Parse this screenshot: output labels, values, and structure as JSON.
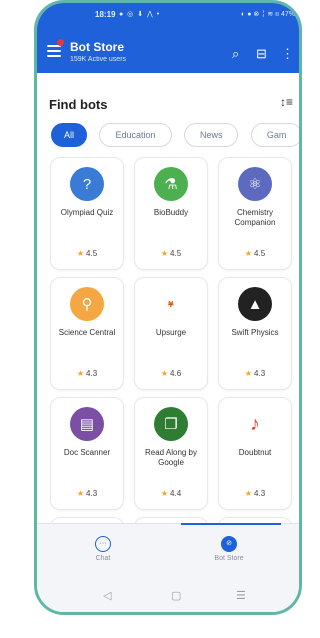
{
  "status_bar": {
    "time": "18:19",
    "left_icons": "● ◎ ⬇ ⋀ •",
    "right_icons": "◐ ● ⊗ ╎ ≋ ıı 47%"
  },
  "app_bar": {
    "title": "Bot Store",
    "subtitle": "159K Active users",
    "search_icon": "search-icon",
    "scan_icon": "scan-icon",
    "more_icon": "more-vertical-icon"
  },
  "section": {
    "title": "Find bots",
    "sort_icon": "sort-icon"
  },
  "chips": [
    "All",
    "Education",
    "News",
    "Gam"
  ],
  "bots": [
    {
      "name": "Olympiad Quiz",
      "rating": "4.5",
      "icon": "?",
      "color": "#3a7bd5"
    },
    {
      "name": "BioBuddy",
      "rating": "4.5",
      "icon": "⚗",
      "color": "#4caf50"
    },
    {
      "name": "Chemistry Companion",
      "rating": "4.5",
      "icon": "⚛",
      "color": "#5c6bc0"
    },
    {
      "name": "Science Central",
      "rating": "4.3",
      "icon": "🔍",
      "color": "#f4a742"
    },
    {
      "name": "Upsurge",
      "rating": "4.6",
      "icon": "upsurge",
      "color": "#ffffff"
    },
    {
      "name": "Swift Physics",
      "rating": "4.3",
      "icon": "🚀",
      "color": "#222222"
    },
    {
      "name": "Doc Scanner",
      "rating": "4.3",
      "icon": "▤",
      "color": "#7b4fa3"
    },
    {
      "name": "Read Along by Google",
      "rating": "4.4",
      "icon": "📖",
      "color": "#2e7d32"
    },
    {
      "name": "Doubtnut",
      "rating": "4.3",
      "icon": "♪",
      "color": "#ffffff"
    }
  ],
  "bottom_nav": {
    "chat_label": "Chat",
    "bot_store_label": "Bot Store"
  },
  "system_nav": {
    "back": "◁",
    "home": "▢",
    "recents": "☰"
  }
}
